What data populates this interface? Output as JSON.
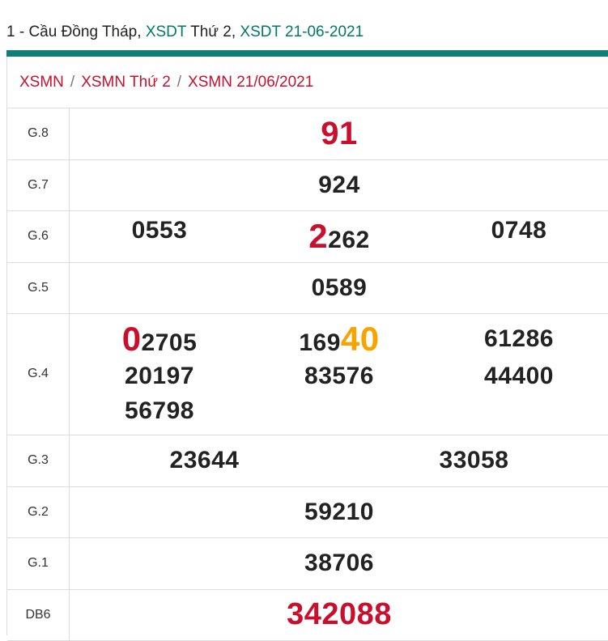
{
  "title": {
    "prefix": "1 - Cầu Đồng Tháp, ",
    "link1": "XSDT",
    "middle": " Thứ 2, ",
    "link2": "XSDT 21-06-2021"
  },
  "breadcrumb": [
    "XSMN",
    "XSMN Thứ 2",
    "XSMN 21/06/2021"
  ],
  "breadcrumb_sep": "/",
  "colors": {
    "teal": "#117d7a",
    "red": "#c8102e",
    "orange": "#f7a400"
  },
  "prizes": {
    "g8": {
      "label": "G.8",
      "values": [
        "91"
      ]
    },
    "g7": {
      "label": "G.7",
      "values": [
        "924"
      ]
    },
    "g6": {
      "label": "G.6",
      "values": [
        "0553",
        "2262",
        "0748"
      ]
    },
    "g5": {
      "label": "G.5",
      "values": [
        "0589"
      ]
    },
    "g4": {
      "label": "G.4",
      "values": [
        "02705",
        "16940",
        "61286",
        "20197",
        "83576",
        "44400",
        "56798"
      ]
    },
    "g3": {
      "label": "G.3",
      "values": [
        "23644",
        "33058"
      ]
    },
    "g2": {
      "label": "G.2",
      "values": [
        "59210"
      ]
    },
    "g1": {
      "label": "G.1",
      "values": [
        "38706"
      ]
    },
    "db": {
      "label": "DB6",
      "values": [
        "342088"
      ]
    }
  },
  "highlights": {
    "g6_1_head": "2",
    "g6_1_tail": "262",
    "g4_1_head": "0",
    "g4_1_tail": "2705",
    "g4_2_head": "169",
    "g4_2_tail": "40"
  }
}
